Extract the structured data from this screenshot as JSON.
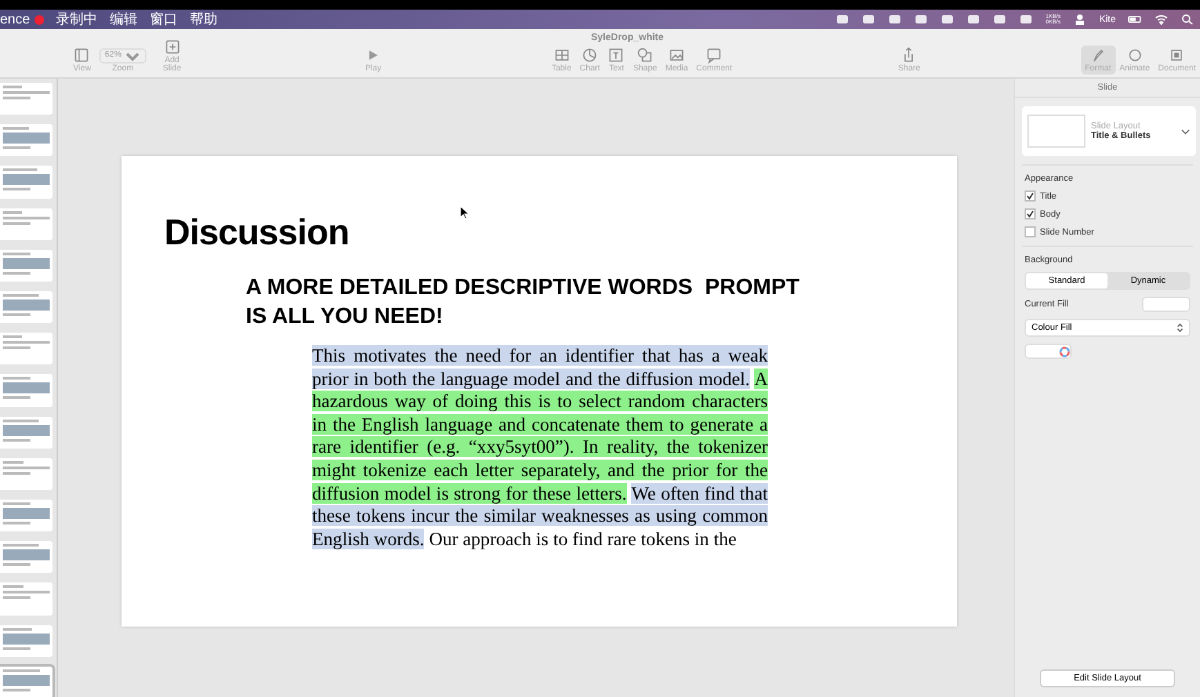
{
  "menubar": {
    "app": "ence",
    "recording": "录制中",
    "menus": [
      "编辑",
      "窗口",
      "帮助"
    ],
    "net_up": "1KB/s",
    "net_down": "0KB/s",
    "kite": "Kite"
  },
  "window": {
    "title": "SyleDrop_white"
  },
  "toolbar": {
    "zoom": "62%",
    "left": [
      {
        "kind": "view",
        "label": "View"
      },
      {
        "kind": "zoom",
        "label": "Zoom"
      },
      {
        "kind": "add",
        "label": "Add Slide"
      }
    ],
    "play": {
      "label": "Play"
    },
    "insert": [
      {
        "kind": "table",
        "label": "Table"
      },
      {
        "kind": "chart",
        "label": "Chart"
      },
      {
        "kind": "text",
        "label": "Text"
      },
      {
        "kind": "shape",
        "label": "Shape"
      },
      {
        "kind": "media",
        "label": "Media"
      },
      {
        "kind": "comment",
        "label": "Comment"
      }
    ],
    "share": {
      "label": "Share"
    },
    "right": [
      {
        "kind": "format",
        "label": "Format",
        "selected": true
      },
      {
        "kind": "animate",
        "label": "Animate",
        "selected": false
      },
      {
        "kind": "document",
        "label": "Document",
        "selected": false
      }
    ]
  },
  "thumbnails": [
    {
      "selected": false
    },
    {
      "selected": false
    },
    {
      "selected": false
    },
    {
      "selected": false
    },
    {
      "selected": false
    },
    {
      "selected": false
    },
    {
      "selected": false
    },
    {
      "selected": false
    },
    {
      "selected": false
    },
    {
      "selected": false
    },
    {
      "selected": false
    },
    {
      "selected": false
    },
    {
      "selected": false
    },
    {
      "selected": false
    },
    {
      "selected": true
    }
  ],
  "slide": {
    "title": "Discussion",
    "subtitle": "A MORE DETAILED DESCRIPTIVE WORDS  PROMPT IS ALL YOU NEED!",
    "body": [
      {
        "text": "This motivates the need for an identifier that has a weak prior in both the language model and the diffusion model.",
        "color": "#c9d6ec"
      },
      {
        "text": "A hazardous way of doing this is to select random characters in the English language and concatenate them to generate a rare identifier (e.g. “xxy5syt00”). In reality, the tokenizer might tokenize each letter separately, and the prior for the diffusion model is strong for these letters.",
        "color": "#8ef08a"
      },
      {
        "text": "We often find that these tokens incur the similar weaknesses as using common English words.",
        "color": "#c9d6ec"
      },
      {
        "text": "Our approach is to find rare tokens in the"
      }
    ]
  },
  "inspector": {
    "header": "Slide",
    "layout_label": "Slide Layout",
    "layout_value": "Title & Bullets",
    "appearance": {
      "heading": "Appearance",
      "items": [
        {
          "label": "Title",
          "checked": true
        },
        {
          "label": "Body",
          "checked": true
        },
        {
          "label": "Slide Number",
          "checked": false
        }
      ]
    },
    "background": {
      "heading": "Background",
      "options": [
        {
          "label": "Standard",
          "selected": true
        },
        {
          "label": "Dynamic",
          "selected": false
        }
      ]
    },
    "current_fill": "Current Fill",
    "fill_type": "Colour Fill",
    "edit_button": "Edit Slide Layout"
  }
}
